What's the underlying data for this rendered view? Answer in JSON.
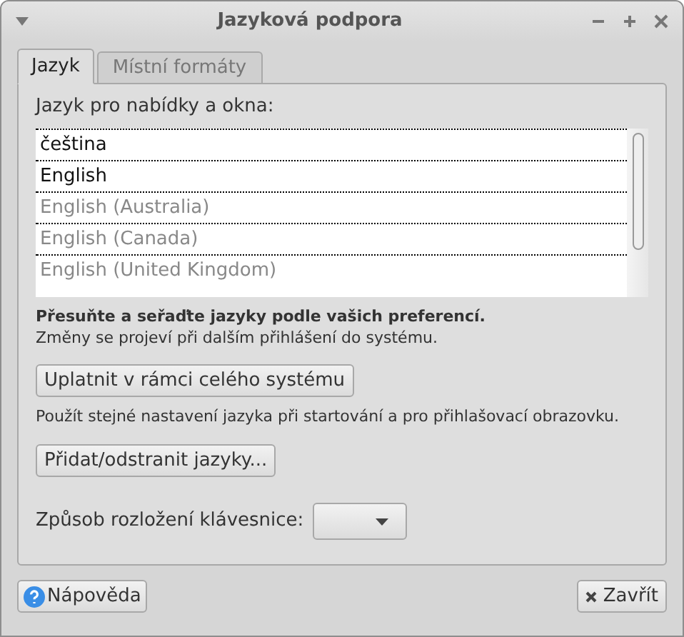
{
  "window": {
    "title": "Jazyková podpora"
  },
  "tabs": [
    {
      "label": "Jazyk",
      "selected": true
    },
    {
      "label": "Místní formáty",
      "selected": false
    }
  ],
  "language_list": {
    "label": "Jazyk pro nabídky a okna:",
    "items": [
      {
        "label": "čeština",
        "disabled": false
      },
      {
        "label": "English",
        "disabled": false
      },
      {
        "label": "English (Australia)",
        "disabled": true
      },
      {
        "label": "English (Canada)",
        "disabled": true
      },
      {
        "label": "English (United Kingdom)",
        "disabled": true
      }
    ]
  },
  "hint_bold": "Přesuňte a seřaďte jazyky podle vašich preferencí.",
  "hint": "Změny se projeví při dalším přihlášení do systému.",
  "apply_button": "Uplatnit v rámci celého systému",
  "apply_note": "Použít stejné nastavení jazyka při startování a pro přihlašovací obrazovku.",
  "add_remove_button": "Přidat/odstranit jazyky...",
  "keyboard": {
    "label": "Způsob rozložení klávesnice:"
  },
  "buttons": {
    "help": "Nápověda",
    "close": "Zavřít"
  }
}
